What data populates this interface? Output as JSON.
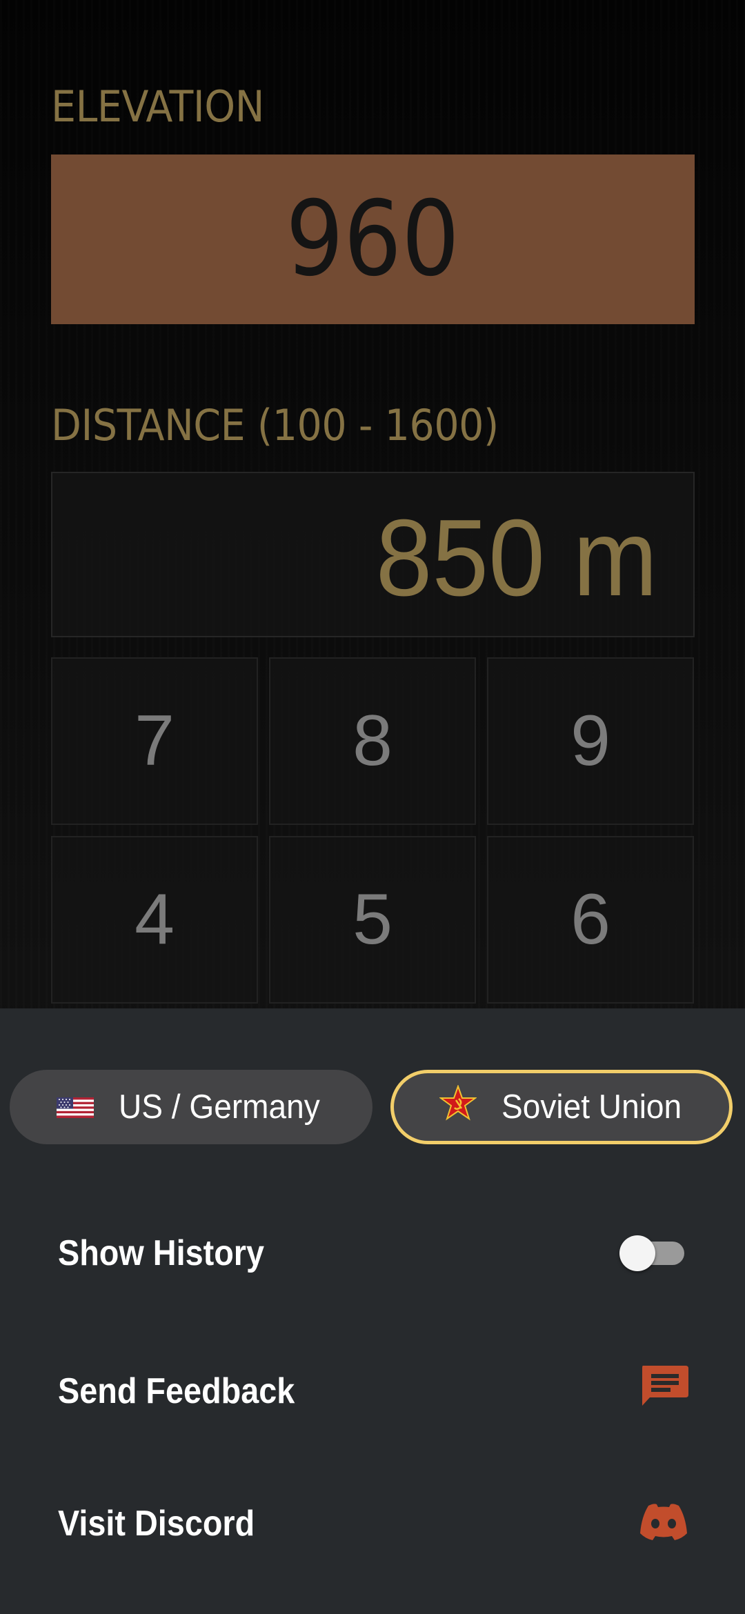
{
  "elevation": {
    "label": "ELEVATION",
    "value": "960",
    "background_color": "#734b33"
  },
  "distance": {
    "label": "DISTANCE (100 - 1600)",
    "value": "850 m",
    "text_color": "#857244"
  },
  "keypad": {
    "keys": [
      "7",
      "8",
      "9",
      "4",
      "5",
      "6"
    ]
  },
  "bottom_sheet": {
    "factions": [
      {
        "label": "US / Germany",
        "icon": "us-flag-icon",
        "selected": false
      },
      {
        "label": "Soviet Union",
        "icon": "soviet-star-icon",
        "selected": true
      }
    ],
    "selected_border_color": "#f2ce6a",
    "settings": [
      {
        "label": "Show History",
        "control": "toggle",
        "toggle_on": false
      },
      {
        "label": "Send Feedback",
        "icon": "feedback-icon"
      },
      {
        "label": "Visit Discord",
        "icon": "discord-icon"
      }
    ],
    "accent_icon_color": "#c24d2c"
  }
}
